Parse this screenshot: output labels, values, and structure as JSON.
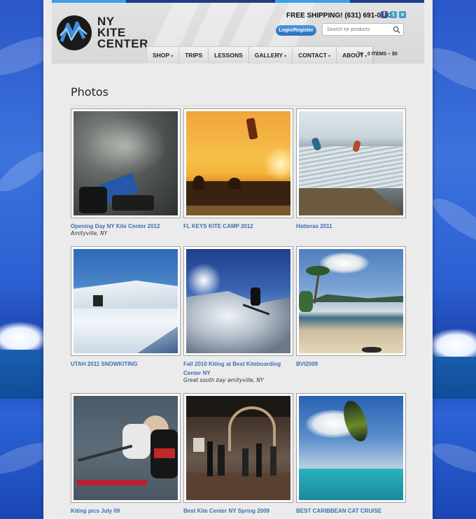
{
  "header": {
    "logo_lines": [
      "NY",
      "KITE",
      "CENTER"
    ],
    "free_shipping": "FREE SHIPPING! (631) 691-0793",
    "social": [
      {
        "icon": "facebook-icon",
        "glyph": "f",
        "color": "#3b5998"
      },
      {
        "icon": "twitter-icon",
        "glyph": "t",
        "color": "#4a9fd0"
      },
      {
        "icon": "vimeo-icon",
        "glyph": "v",
        "color": "#3aa0c4"
      }
    ],
    "login_label": "Login/Register",
    "search_placeholder": "Search for products",
    "cart_label": "0 ITEMS – $0"
  },
  "nav": [
    {
      "label": "SHOP",
      "dropdown": true
    },
    {
      "label": "TRIPS",
      "dropdown": false
    },
    {
      "label": "LESSONS",
      "dropdown": false
    },
    {
      "label": "GALLERY",
      "dropdown": true
    },
    {
      "label": "CONTACT",
      "dropdown": true
    },
    {
      "label": "ABOUT",
      "dropdown": true
    }
  ],
  "page_title": "Photos",
  "gallery": [
    {
      "caption": "Opening Day NY Kite Center 2012",
      "location": "Amityville, NY"
    },
    {
      "caption": "FL KEYS KITE CAMP 2012",
      "location": ""
    },
    {
      "caption": "Hatteras 2011",
      "location": ""
    },
    {
      "caption": "UTAH 2011 SNOWKITING",
      "location": ""
    },
    {
      "caption": "Fall 2010 Kiting at Best Kiteboarding Center NY",
      "location": "Great south bay amityville, NY"
    },
    {
      "caption": "BVI2009",
      "location": ""
    },
    {
      "caption": "Kiting pics July 09",
      "location": ""
    },
    {
      "caption": "Best Kite Center NY Spring 2009",
      "location": ""
    },
    {
      "caption": "BEST CARIBBEAN CAT CRUISE",
      "location": ""
    }
  ],
  "colors": {
    "link": "#3d6eb5",
    "topbar": [
      "#3aa0e8",
      "#1d3c8f",
      "#223d7a",
      "#3aa0e8",
      "#1d3c8f"
    ]
  }
}
